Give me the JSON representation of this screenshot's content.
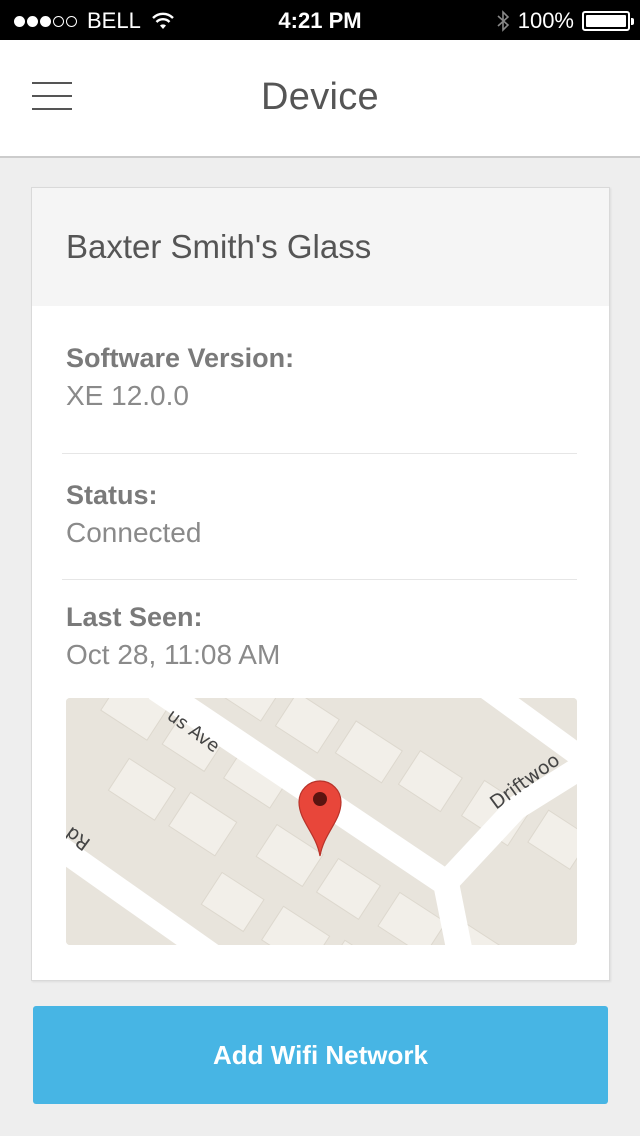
{
  "status_bar": {
    "signal_strength": {
      "filled": 3,
      "total": 5
    },
    "carrier": "BELL",
    "time": "4:21 PM",
    "battery_percent": "100%",
    "battery_level": 1.0,
    "icons": [
      "wifi-icon",
      "bluetooth-icon",
      "battery-icon"
    ]
  },
  "nav": {
    "title": "Device",
    "menu_icon": "hamburger-menu-icon"
  },
  "device": {
    "name": "Baxter Smith's Glass",
    "fields": [
      {
        "label": "Software Version:",
        "value": "XE 12.0.0"
      },
      {
        "label": "Status:",
        "value": "Connected"
      },
      {
        "label": "Last Seen:",
        "value": "Oct 28, 11:08 AM"
      }
    ]
  },
  "map": {
    "street_labels": [
      "us Ave",
      "Driftwoo",
      "Rd"
    ],
    "marker": "map-pin-icon",
    "marker_color": "#e8463a"
  },
  "actions": {
    "add_wifi_label": "Add Wifi Network",
    "add_wifi_color": "#47b5e4"
  }
}
